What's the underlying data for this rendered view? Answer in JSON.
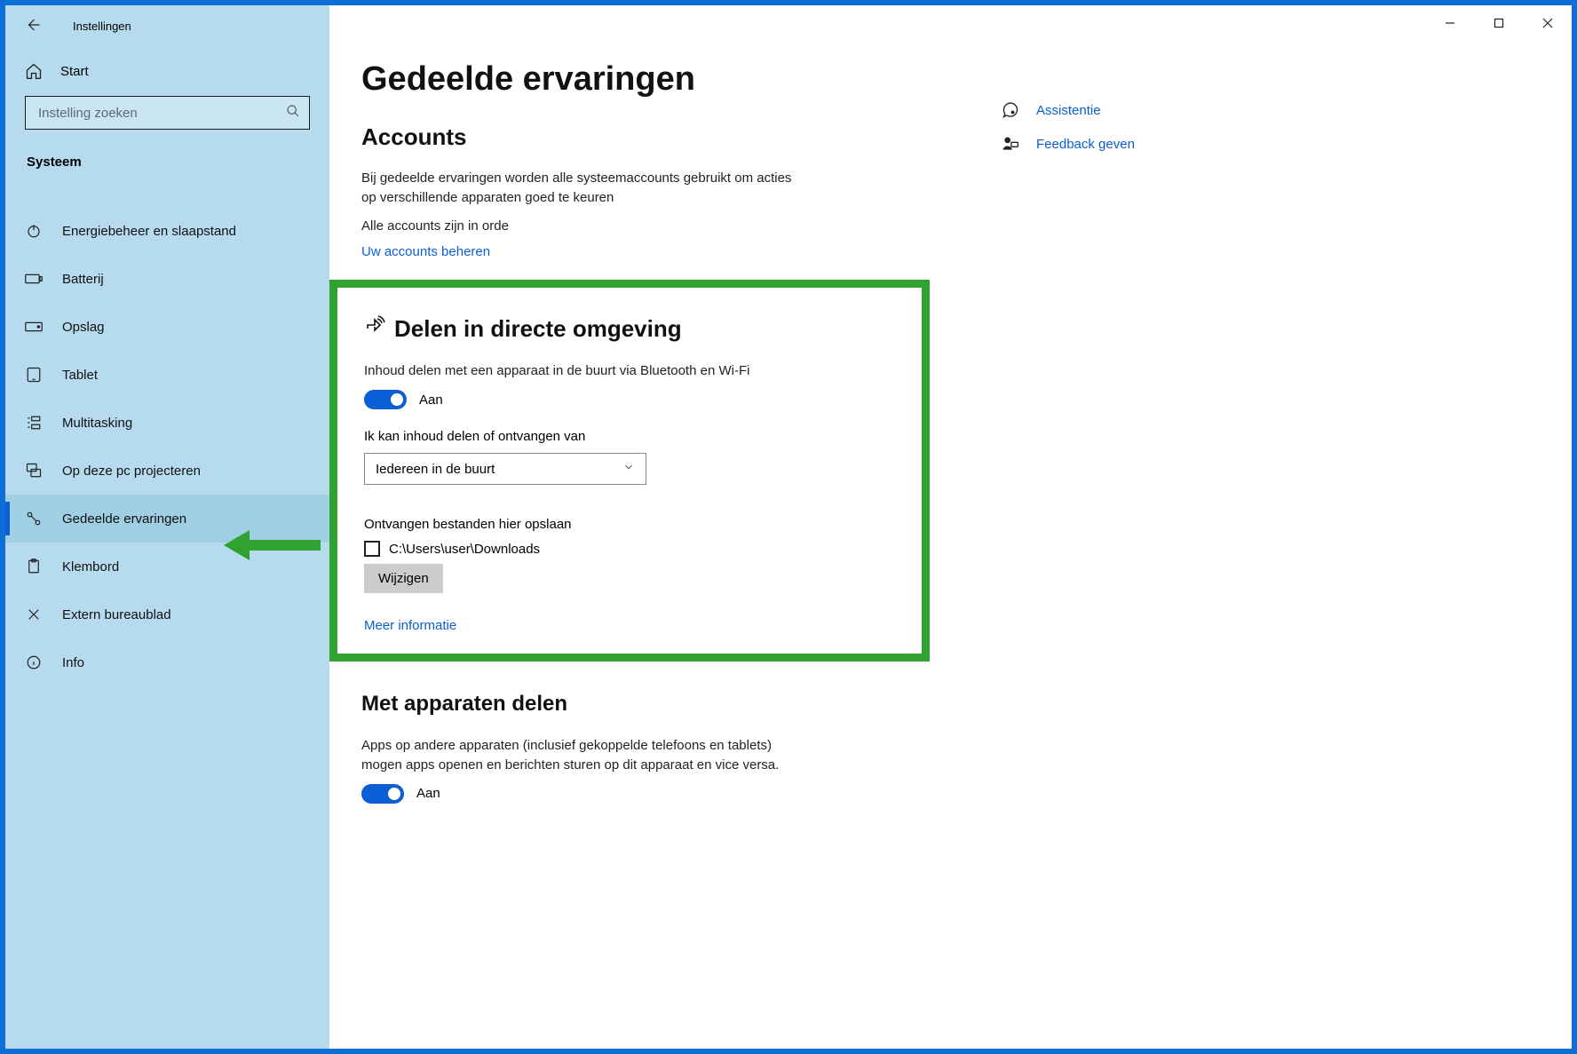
{
  "window_title": "Instellingen",
  "sidebar": {
    "start_label": "Start",
    "search_placeholder": "Instelling zoeken",
    "section": "Systeem",
    "truncated_top": " ",
    "items": [
      {
        "id": "power",
        "icon": "power-icon",
        "label": "Energiebeheer en slaapstand"
      },
      {
        "id": "battery",
        "icon": "battery-icon",
        "label": "Batterij"
      },
      {
        "id": "storage",
        "icon": "storage-icon",
        "label": "Opslag"
      },
      {
        "id": "tablet",
        "icon": "tablet-icon",
        "label": "Tablet"
      },
      {
        "id": "multitask",
        "icon": "multitask-icon",
        "label": "Multitasking"
      },
      {
        "id": "project",
        "icon": "project-icon",
        "label": "Op deze pc projecteren"
      },
      {
        "id": "shared",
        "icon": "shared-icon",
        "label": "Gedeelde ervaringen",
        "active": true
      },
      {
        "id": "clipboard",
        "icon": "clipboard-icon",
        "label": "Klembord"
      },
      {
        "id": "remote",
        "icon": "remote-icon",
        "label": "Extern bureaublad"
      },
      {
        "id": "info",
        "icon": "info-icon",
        "label": "Info"
      }
    ]
  },
  "main": {
    "page_title": "Gedeelde ervaringen",
    "accounts": {
      "heading": "Accounts",
      "desc": "Bij gedeelde ervaringen worden alle systeemaccounts gebruikt om acties op verschillende apparaten goed te keuren",
      "ok_line": "Alle accounts zijn in orde",
      "manage_link": "Uw accounts beheren"
    },
    "nearby": {
      "heading": "Delen in directe omgeving",
      "desc": "Inhoud delen met een apparaat in de buurt via Bluetooth en Wi-Fi",
      "toggle_state": "Aan",
      "share_from_label": "Ik kan inhoud delen of ontvangen van",
      "share_from_value": "Iedereen in de buurt",
      "save_to_label": "Ontvangen bestanden hier opslaan",
      "save_to_path": "C:\\Users\\user\\Downloads",
      "change_btn": "Wijzigen",
      "more_info": "Meer informatie"
    },
    "across": {
      "heading": "Met apparaten delen",
      "desc": "Apps op andere apparaten (inclusief gekoppelde telefoons en tablets) mogen apps openen en berichten sturen op dit apparaat en vice versa.",
      "toggle_state": "Aan"
    }
  },
  "right": {
    "help": "Assistentie",
    "feedback": "Feedback geven"
  }
}
